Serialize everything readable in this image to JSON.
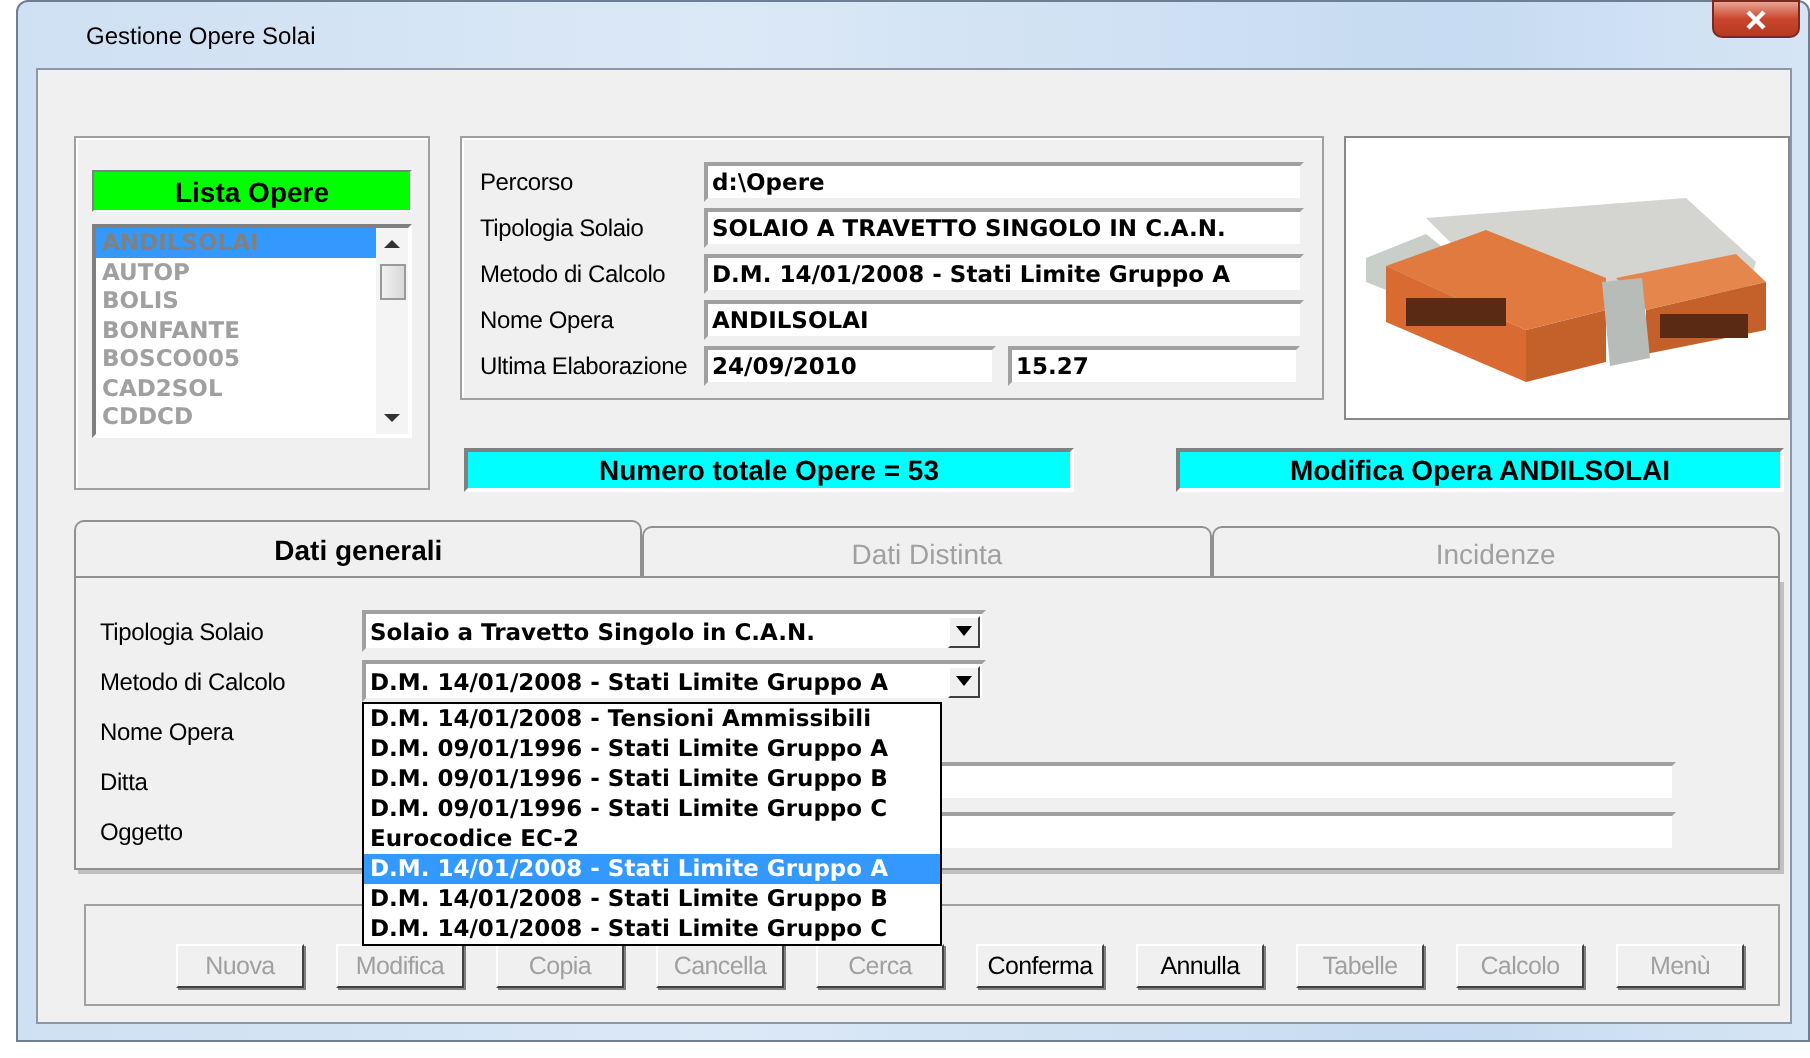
{
  "window": {
    "title": "Gestione Opere Solai"
  },
  "works_list": {
    "title": "Lista Opere",
    "items": [
      {
        "label": "ANDILSOLAI",
        "selected": true
      },
      {
        "label": "AUTOP",
        "selected": false
      },
      {
        "label": "BOLIS",
        "selected": false
      },
      {
        "label": "BONFANTE",
        "selected": false
      },
      {
        "label": "BOSCO005",
        "selected": false
      },
      {
        "label": "CAD2SOL",
        "selected": false
      },
      {
        "label": "CDDCD",
        "selected": false
      }
    ]
  },
  "info": {
    "fields": [
      {
        "label": "Percorso",
        "value": "d:\\Opere"
      },
      {
        "label": "Tipologia Solaio",
        "value": "SOLAIO A TRAVETTO SINGOLO IN C.A.N."
      },
      {
        "label": "Metodo di Calcolo",
        "value": "D.M. 14/01/2008 - Stati Limite Gruppo A"
      },
      {
        "label": "Nome Opera",
        "value": "ANDILSOLAI"
      }
    ],
    "last": {
      "label": "Ultima Elaborazione",
      "date": "24/09/2010",
      "time": "15.27"
    }
  },
  "total": "Numero totale Opere = 53",
  "mode": "Modifica Opera  ANDILSOLAI",
  "tabs": [
    {
      "label": "Dati generali",
      "selected": true
    },
    {
      "label": "Dati Distinta",
      "selected": false
    },
    {
      "label": "Incidenze",
      "selected": false
    }
  ],
  "form": {
    "rows": [
      {
        "kind": "combo",
        "label": "Tipologia Solaio",
        "value": "Solaio a Travetto Singolo in C.A.N."
      },
      {
        "kind": "combo",
        "label": "Metodo di Calcolo",
        "value": "D.M. 14/01/2008 - Stati Limite Gruppo A"
      },
      {
        "kind": "label",
        "label": "Nome Opera"
      },
      {
        "kind": "text",
        "label": "Ditta"
      },
      {
        "kind": "text",
        "label": "Oggetto"
      }
    ]
  },
  "dropdown": {
    "options": [
      {
        "label": "D.M. 14/01/2008 - Tensioni Ammissibili",
        "selected": false
      },
      {
        "label": "D.M. 09/01/1996 - Stati Limite Gruppo A",
        "selected": false
      },
      {
        "label": "D.M. 09/01/1996 - Stati Limite Gruppo B",
        "selected": false
      },
      {
        "label": "D.M. 09/01/1996 - Stati Limite Gruppo C",
        "selected": false
      },
      {
        "label": "Eurocodice EC-2",
        "selected": false
      },
      {
        "label": "D.M. 14/01/2008 - Stati Limite Gruppo A",
        "selected": true
      },
      {
        "label": "D.M. 14/01/2008 - Stati Limite Gruppo B",
        "selected": false
      },
      {
        "label": "D.M. 14/01/2008 - Stati Limite Gruppo C",
        "selected": false
      }
    ]
  },
  "buttons": [
    {
      "label": "Nuova",
      "disabled": true
    },
    {
      "label": "Modifica",
      "disabled": true
    },
    {
      "label": "Copia",
      "disabled": true
    },
    {
      "label": "Cancella",
      "disabled": true
    },
    {
      "label": "Cerca",
      "disabled": true
    },
    {
      "label": "Conferma",
      "disabled": false
    },
    {
      "label": "Annulla",
      "disabled": false
    },
    {
      "label": "Tabelle",
      "disabled": true
    },
    {
      "label": "Calcolo",
      "disabled": true
    },
    {
      "label": "Menù",
      "disabled": true
    }
  ]
}
